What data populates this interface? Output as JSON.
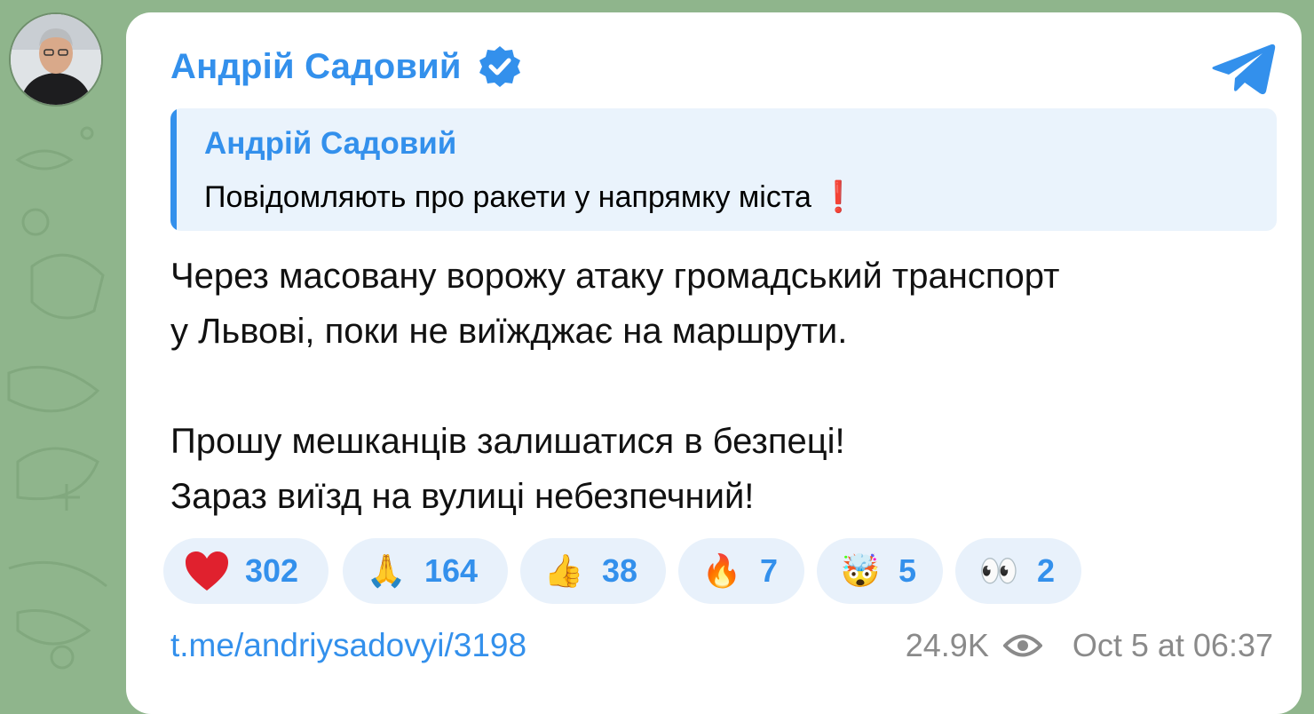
{
  "channel": {
    "name": "Андрій Садовий",
    "verified_icon": "verified-badge-icon",
    "logo_icon": "telegram-logo-icon"
  },
  "reply": {
    "author": "Андрій Садовий",
    "text": "Повідомляють про ракети у напрямку міста",
    "emoji": "❗"
  },
  "message": {
    "paragraph1_line1": "Через масовану ворожу атаку громадський транспорт",
    "paragraph1_line2": "у Львові, поки не виїжджає на маршрути.",
    "paragraph2_line1": "Прошу мешканців залишатися в безпеці!",
    "paragraph2_line2": "Зараз виїзд на вулиці небезпечний!"
  },
  "reactions": [
    {
      "emoji": "❤️",
      "name": "heart",
      "count": "302"
    },
    {
      "emoji": "🙏",
      "name": "pray",
      "count": "164"
    },
    {
      "emoji": "👍",
      "name": "thumbs-up",
      "count": "38"
    },
    {
      "emoji": "🔥",
      "name": "fire",
      "count": "7"
    },
    {
      "emoji": "🤯",
      "name": "exploding-head",
      "count": "5"
    },
    {
      "emoji": "👀",
      "name": "eyes",
      "count": "2"
    }
  ],
  "footer": {
    "link": "t.me/andriysadovyi/3198",
    "views": "24.9K",
    "date": "Oct 5 at 06:37"
  },
  "colors": {
    "accent": "#3390ec",
    "background": "#8fb58c",
    "reply_bg": "#eaf3fc",
    "reaction_bg": "#e8f1fb"
  }
}
